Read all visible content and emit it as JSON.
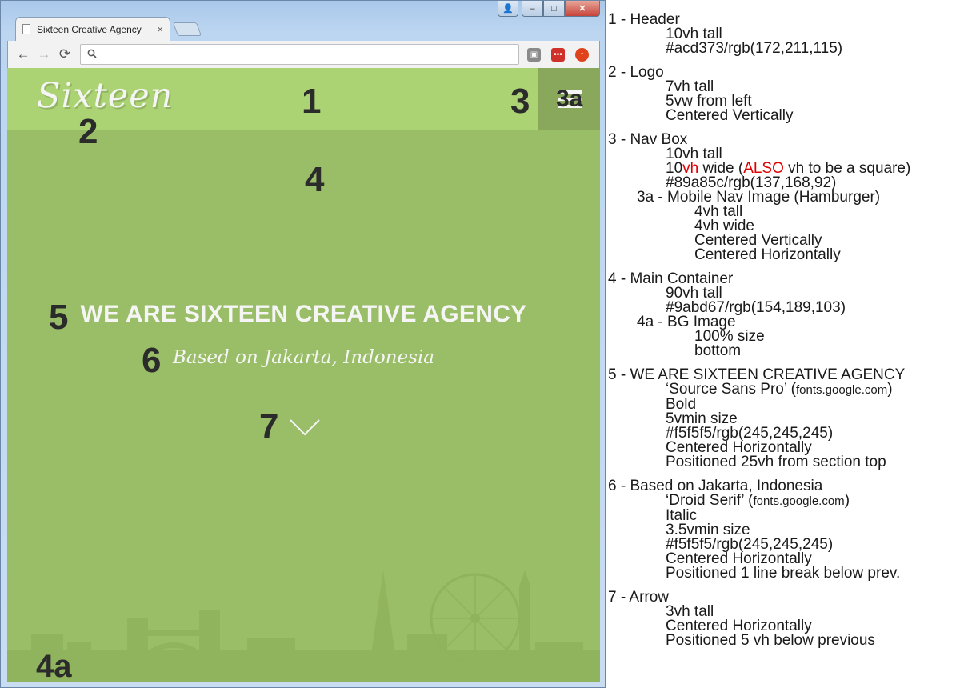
{
  "browser": {
    "tab_title": "Sixteen Creative Agency",
    "tab_close": "×",
    "address_placeholder": "",
    "window_buttons": {
      "user": "👤",
      "minimize": "–",
      "maximize": "□",
      "close": "✕"
    },
    "nav": {
      "back": "←",
      "forward": "→",
      "reload": "⟳",
      "search": "🔍"
    }
  },
  "page": {
    "logo_text": "Sixteen",
    "headline": "WE ARE SIXTEEN CREATIVE AGENCY",
    "subline": "Based on Jakarta, Indonesia",
    "colors": {
      "header": "#acd373",
      "navbox": "#89a85c",
      "main": "#9abd67",
      "text": "#f5f5f5"
    }
  },
  "markers": {
    "m1": "1",
    "m2": "2",
    "m3": "3",
    "m3a": "3a",
    "m4": "4",
    "m5": "5",
    "m6": "6",
    "m7": "7",
    "m4a": "4a"
  },
  "notes": {
    "s1": {
      "title": "1 - Header",
      "lines": [
        "10vh tall",
        "#acd373/rgb(172,211,115)"
      ]
    },
    "s2": {
      "title": "2 - Logo",
      "lines": [
        "7vh tall",
        "5vw from left",
        "Centered Vertically"
      ]
    },
    "s3": {
      "title": "3 - Nav Box",
      "l1": "10vh tall",
      "l2_a": "10",
      "l2_b": "vh",
      "l2_c": " wide (",
      "l2_d": "ALSO",
      "l2_e": " vh to be a square)",
      "l3": "#89a85c/rgb(137,168,92)",
      "sub_title": "3a - Mobile Nav Image (Hamburger)",
      "sub_lines": [
        "4vh tall",
        "4vh wide",
        "Centered Vertically",
        "Centered Horizontally"
      ]
    },
    "s4": {
      "title": "4 - Main Container",
      "lines": [
        "90vh tall",
        "#9abd67/rgb(154,189,103)"
      ],
      "sub_title": "4a - BG Image",
      "sub_lines": [
        "100% size",
        "bottom"
      ]
    },
    "s5": {
      "title": "5 - WE ARE SIXTEEN CREATIVE AGENCY",
      "l1_a": "‘Source Sans Pro’ (",
      "l1_b": "fonts.google.com",
      "l1_c": ")",
      "lines": [
        "Bold",
        "5vmin size",
        "#f5f5f5/rgb(245,245,245)",
        "Centered Horizontally",
        "Positioned 25vh from section top"
      ]
    },
    "s6": {
      "title": "6 - Based on Jakarta, Indonesia",
      "l1_a": "‘Droid Serif’ (",
      "l1_b": "fonts.google.com",
      "l1_c": ")",
      "lines": [
        "Italic",
        "3.5vmin size",
        "#f5f5f5/rgb(245,245,245)",
        "Centered Horizontally",
        "Positioned 1 line break below prev."
      ]
    },
    "s7": {
      "title": "7 - Arrow",
      "lines": [
        "3vh tall",
        "Centered Horizontally",
        "Positioned 5 vh below previous"
      ]
    }
  }
}
